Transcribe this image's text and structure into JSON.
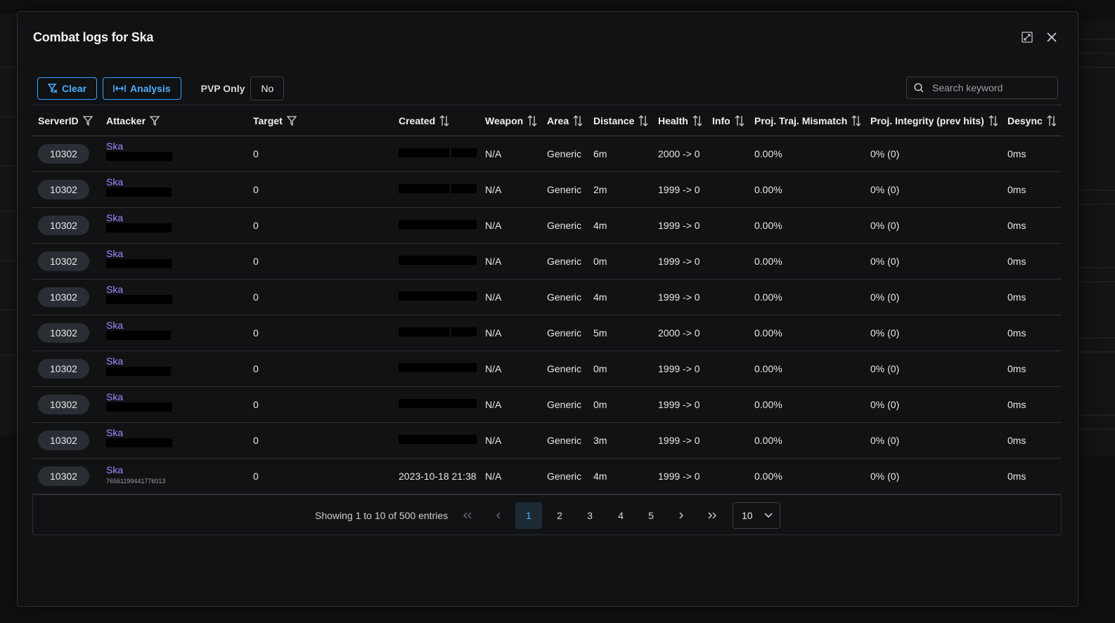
{
  "modal": {
    "title": "Combat logs for Ska"
  },
  "toolbar": {
    "clear_label": "Clear",
    "analysis_label": "Analysis",
    "pvp_label": "PVP Only",
    "pvp_value": "No",
    "search_placeholder": "Search keyword"
  },
  "table": {
    "columns": [
      "ServerID",
      "Attacker",
      "Target",
      "Created",
      "Weapon",
      "Area",
      "Distance",
      "Health",
      "Info",
      "Proj. Traj. Mismatch",
      "Proj. Integrity (prev hits)",
      "Desync"
    ],
    "rows": [
      {
        "server_id": "10302",
        "attacker": "Ska",
        "target": "0",
        "created": "",
        "weapon": "N/A",
        "area": "Generic",
        "distance": "6m",
        "health": "2000 -> 0",
        "mismatch": "0.00%",
        "integrity": "0% (0)",
        "desync": "0ms"
      },
      {
        "server_id": "10302",
        "attacker": "Ska",
        "target": "0",
        "created": "",
        "weapon": "N/A",
        "area": "Generic",
        "distance": "2m",
        "health": "1999 -> 0",
        "mismatch": "0.00%",
        "integrity": "0% (0)",
        "desync": "0ms"
      },
      {
        "server_id": "10302",
        "attacker": "Ska",
        "target": "0",
        "created": "",
        "weapon": "N/A",
        "area": "Generic",
        "distance": "4m",
        "health": "1999 -> 0",
        "mismatch": "0.00%",
        "integrity": "0% (0)",
        "desync": "0ms"
      },
      {
        "server_id": "10302",
        "attacker": "Ska",
        "target": "0",
        "created": "",
        "weapon": "N/A",
        "area": "Generic",
        "distance": "0m",
        "health": "1999 -> 0",
        "mismatch": "0.00%",
        "integrity": "0% (0)",
        "desync": "0ms"
      },
      {
        "server_id": "10302",
        "attacker": "Ska",
        "target": "0",
        "created": "",
        "weapon": "N/A",
        "area": "Generic",
        "distance": "4m",
        "health": "1999 -> 0",
        "mismatch": "0.00%",
        "integrity": "0% (0)",
        "desync": "0ms"
      },
      {
        "server_id": "10302",
        "attacker": "Ska",
        "target": "0",
        "created": "",
        "weapon": "N/A",
        "area": "Generic",
        "distance": "5m",
        "health": "2000 -> 0",
        "mismatch": "0.00%",
        "integrity": "0% (0)",
        "desync": "0ms"
      },
      {
        "server_id": "10302",
        "attacker": "Ska",
        "target": "0",
        "created": "",
        "weapon": "N/A",
        "area": "Generic",
        "distance": "0m",
        "health": "1999 -> 0",
        "mismatch": "0.00%",
        "integrity": "0% (0)",
        "desync": "0ms"
      },
      {
        "server_id": "10302",
        "attacker": "Ska",
        "target": "0",
        "created": "",
        "weapon": "N/A",
        "area": "Generic",
        "distance": "0m",
        "health": "1999 -> 0",
        "mismatch": "0.00%",
        "integrity": "0% (0)",
        "desync": "0ms"
      },
      {
        "server_id": "10302",
        "attacker": "Ska",
        "target": "0",
        "created": "",
        "weapon": "N/A",
        "area": "Generic",
        "distance": "3m",
        "health": "1999 -> 0",
        "mismatch": "0.00%",
        "integrity": "0% (0)",
        "desync": "0ms"
      },
      {
        "server_id": "10302",
        "attacker": "Ska",
        "attacker_id": "76561199441776013",
        "target": "0",
        "created": "2023-10-18 21:38",
        "weapon": "N/A",
        "area": "Generic",
        "distance": "4m",
        "health": "1999 -> 0",
        "mismatch": "0.00%",
        "integrity": "0% (0)",
        "desync": "0ms"
      }
    ]
  },
  "pagination": {
    "info": "Showing 1 to 10 of 500 entries",
    "pages": [
      "1",
      "2",
      "3",
      "4",
      "5"
    ],
    "current_page": "1",
    "rows_per_page": "10"
  },
  "colors": {
    "accent": "#51adff",
    "link": "#9f8cff",
    "background": "#101214"
  }
}
